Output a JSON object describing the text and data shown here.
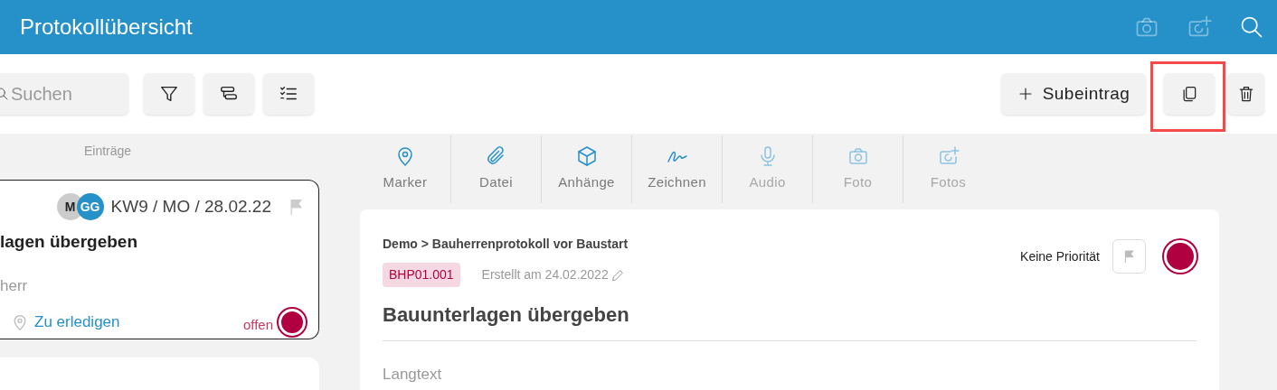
{
  "header": {
    "title": "Protokollübersicht",
    "actions": [
      {
        "kind": "camera",
        "disabled": true
      },
      {
        "kind": "camera-plus",
        "disabled": true
      },
      {
        "kind": "search",
        "disabled": false
      }
    ]
  },
  "toolbar": {
    "search": {
      "placeholder": "Suchen"
    },
    "left_buttons": [
      {
        "kind": "filter"
      },
      {
        "kind": "group"
      },
      {
        "kind": "checklist"
      }
    ],
    "subentry_button": {
      "label": "Subeintrag"
    },
    "copy_button": {
      "highlighted": true
    }
  },
  "entries": {
    "heading": "Einträge",
    "cards": [
      {
        "selected": true,
        "avatars": [
          {
            "initials": "M",
            "color": "#cccccc"
          },
          {
            "initials": "GG",
            "color": "#2690c9"
          }
        ],
        "date": "KW9 / MO / 28.02.22",
        "flagged": false,
        "title": "lagen übergeben",
        "subtitle": "herr",
        "category": "Zu erledigen",
        "status": "offen",
        "color": "#b0003f"
      }
    ]
  },
  "tools": [
    {
      "kind": "marker",
      "label": "Marker",
      "disabled": false
    },
    {
      "kind": "file",
      "label": "Datei",
      "disabled": false
    },
    {
      "kind": "box",
      "label": "Anhänge",
      "disabled": false
    },
    {
      "kind": "draw",
      "label": "Zeichnen",
      "disabled": false
    },
    {
      "kind": "mic",
      "label": "Audio",
      "disabled": true
    },
    {
      "kind": "camera",
      "label": "Foto",
      "disabled": true
    },
    {
      "kind": "camera-plus",
      "label": "Fotos",
      "disabled": true
    }
  ],
  "detail": {
    "breadcrumb": "Demo > Bauherrenprotokoll vor Baustart",
    "code": "BHP01.001",
    "created": "Erstellt am 24.02.2022",
    "priority": "Keine Priorität",
    "flagged": false,
    "color": "#b0003f",
    "title": "Bauunterlagen übergeben",
    "longtext_label": "Langtext"
  }
}
